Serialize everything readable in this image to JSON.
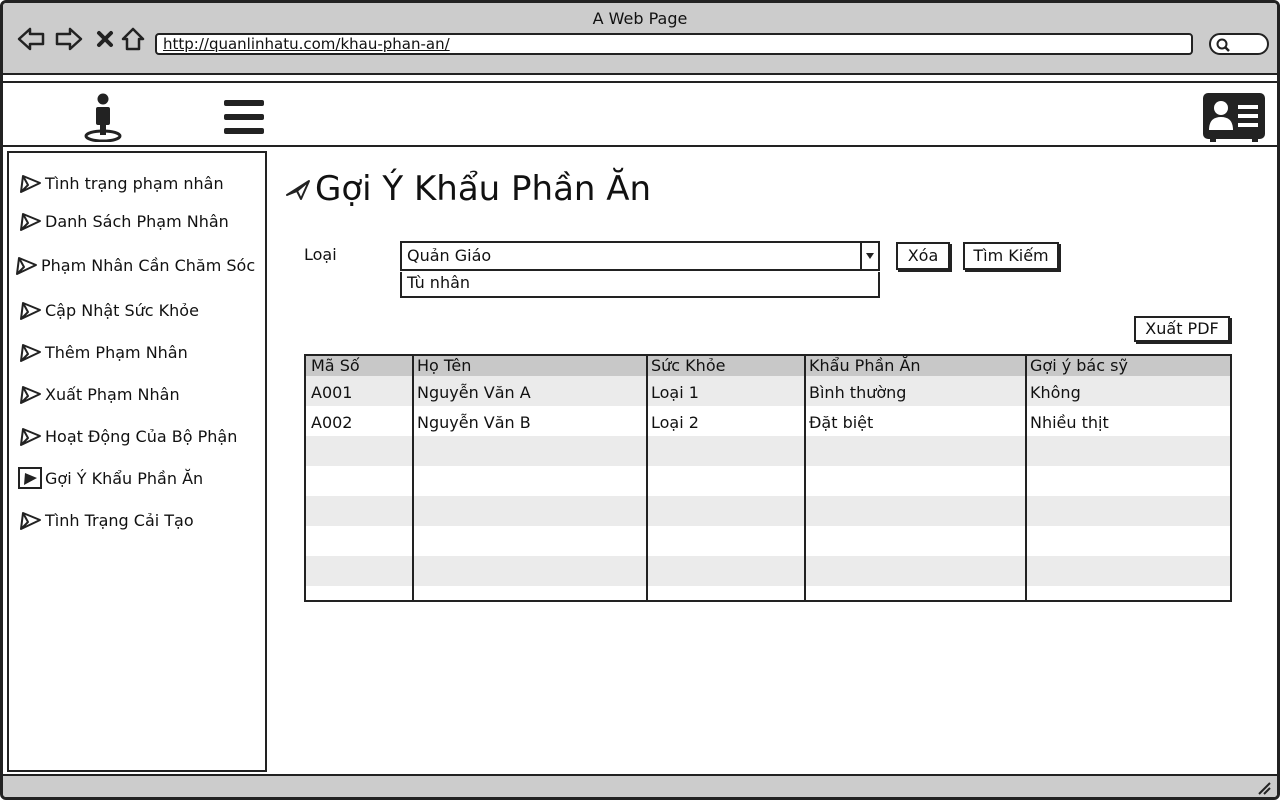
{
  "browser": {
    "title": "A Web Page",
    "url": "http://quanlinhatu.com/khau-phan-an/"
  },
  "sidebar": {
    "items": [
      {
        "label": "Tình trạng phạm nhân"
      },
      {
        "label": "Danh Sách Phạm Nhân"
      },
      {
        "label": "Phạm Nhân Cần Chăm Sóc"
      },
      {
        "label": "Cập Nhật Sức Khỏe"
      },
      {
        "label": "Thêm Phạm Nhân"
      },
      {
        "label": "Xuất Phạm Nhân"
      },
      {
        "label": "Hoạt Động Của Bộ Phận"
      },
      {
        "label": "Gợi Ý Khẩu Phần Ăn"
      },
      {
        "label": "Tình Trạng Cải Tạo"
      }
    ]
  },
  "main": {
    "title": "Gợi Ý Khẩu Phần Ăn",
    "filter_label": "Loại",
    "combo_value": "Quản Giáo",
    "dropdown_option": "Tù nhân",
    "clear_button": "Xóa",
    "search_button": "Tìm Kiếm",
    "export_button": "Xuất PDF"
  },
  "table": {
    "columns": [
      "Mã Số",
      "Họ Tên",
      "Sức Khỏe",
      "Khẩu Phần Ăn",
      "Gợi ý bác sỹ"
    ],
    "rows": [
      [
        "A001",
        "Nguyễn Văn A",
        "Loại 1",
        "Bình thường",
        "Không"
      ],
      [
        "A002",
        "Nguyễn Văn B",
        "Loại 2",
        "Đặt biệt",
        "Nhiều thịt"
      ]
    ]
  },
  "colors": {
    "chrome": "#cccccc",
    "header_row": "#c8c8c8",
    "stripe": "#ebebeb",
    "ink": "#222222"
  }
}
